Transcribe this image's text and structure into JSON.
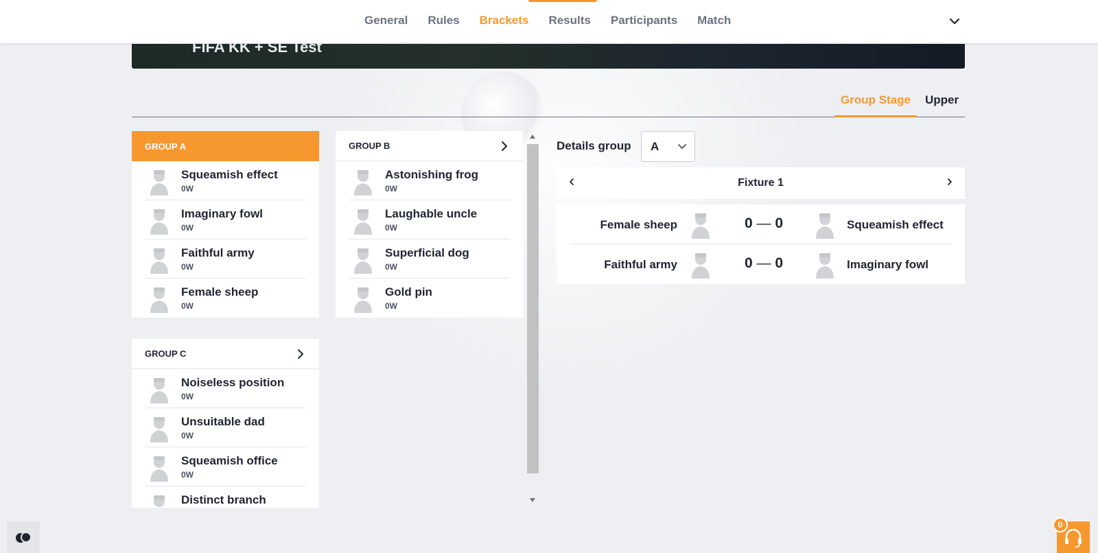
{
  "nav": {
    "tabs": [
      {
        "label": "General"
      },
      {
        "label": "Rules"
      },
      {
        "label": "Brackets",
        "active": true
      },
      {
        "label": "Results"
      },
      {
        "label": "Participants"
      },
      {
        "label": "Match"
      }
    ],
    "chevron_icon": "chevron-down-icon"
  },
  "banner": {
    "title": "FIFA KK + SE Test"
  },
  "stage_tabs": [
    {
      "label": "Group Stage",
      "active": true
    },
    {
      "label": "Upper"
    }
  ],
  "groups": [
    {
      "title": "GROUP A",
      "highlighted": true,
      "teams": [
        {
          "name": "Squeamish effect",
          "wins": "0W"
        },
        {
          "name": "Imaginary fowl",
          "wins": "0W"
        },
        {
          "name": "Faithful army",
          "wins": "0W"
        },
        {
          "name": "Female sheep",
          "wins": "0W"
        }
      ]
    },
    {
      "title": "GROUP B",
      "teams": [
        {
          "name": "Astonishing frog",
          "wins": "0W"
        },
        {
          "name": "Laughable uncle",
          "wins": "0W"
        },
        {
          "name": "Superficial dog",
          "wins": "0W"
        },
        {
          "name": "Gold pin",
          "wins": "0W"
        }
      ]
    },
    {
      "title": "GROUP C",
      "teams": [
        {
          "name": "Noiseless position",
          "wins": "0W"
        },
        {
          "name": "Unsuitable dad",
          "wins": "0W"
        },
        {
          "name": "Squeamish office",
          "wins": "0W"
        },
        {
          "name": "Distinct branch",
          "wins": ""
        }
      ]
    }
  ],
  "details": {
    "label": "Details group",
    "selected_group": "A"
  },
  "fixture": {
    "title": "Fixture 1",
    "matches": [
      {
        "home": "Female sheep",
        "home_score": "0",
        "separator": "—",
        "away_score": "0",
        "away": "Squeamish effect"
      },
      {
        "home": "Faithful army",
        "home_score": "0",
        "separator": "—",
        "away_score": "0",
        "away": "Imaginary fowl"
      }
    ]
  },
  "support": {
    "badge_count": "0"
  },
  "colors": {
    "accent": "#f7982f",
    "text": "#1f2430",
    "muted": "#6b7281",
    "background": "#eeeff2"
  }
}
